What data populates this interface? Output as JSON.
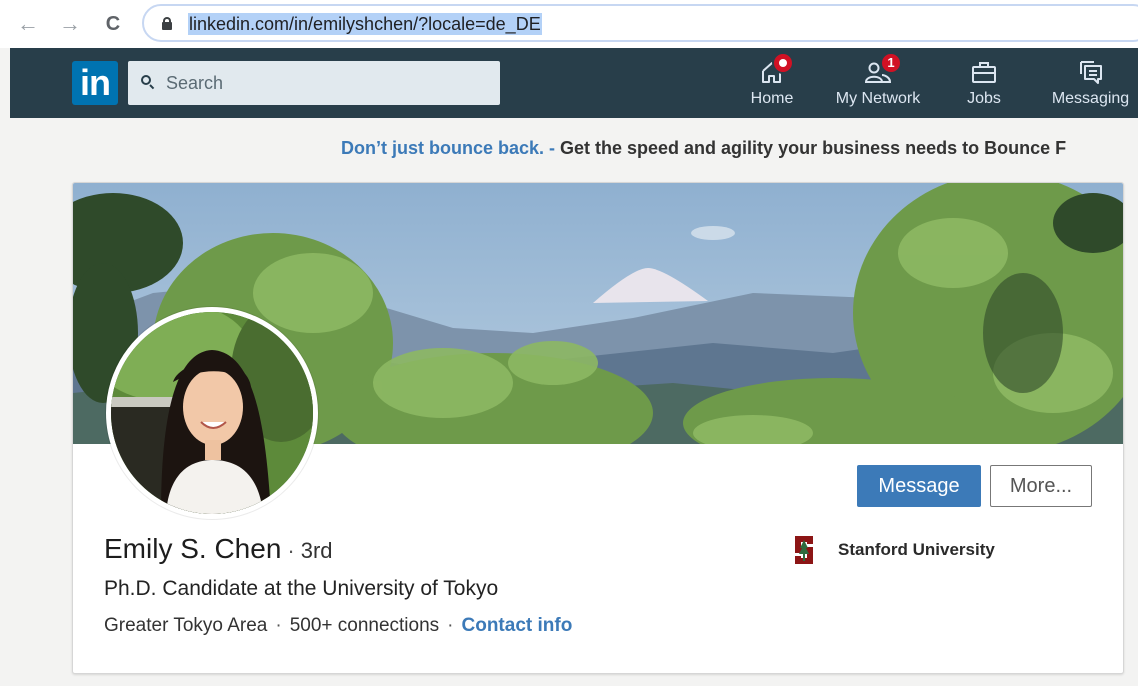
{
  "browser": {
    "back_icon": "arrow-left-icon",
    "forward_icon": "arrow-right-icon",
    "reload_icon": "reload-icon",
    "lock_icon": "lock-icon",
    "url": "linkedin.com/in/emilyshchen/?locale=de_DE"
  },
  "nav": {
    "logo": "in",
    "search_placeholder": "Search",
    "items": [
      {
        "label": "Home",
        "icon": "home-icon",
        "badge": "dot"
      },
      {
        "label": "My Network",
        "icon": "network-icon",
        "badge": "1"
      },
      {
        "label": "Jobs",
        "icon": "briefcase-icon",
        "badge": ""
      },
      {
        "label": "Messaging",
        "icon": "messaging-icon",
        "badge": ""
      }
    ]
  },
  "ad": {
    "link": "Don’t just bounce back. -",
    "text": " Get the speed and agility your business needs to Bounce F"
  },
  "profile": {
    "name": "Emily S. Chen",
    "separator": "·",
    "degree": "3rd",
    "headline": "Ph.D. Candidate at the University of Tokyo",
    "location": "Greater Tokyo Area",
    "connections": "500+ connections",
    "contact_info": "Contact info",
    "school": "Stanford University",
    "buttons": {
      "message": "Message",
      "more": "More..."
    }
  },
  "colors": {
    "nav_bg": "#283e4a",
    "brand_blue": "#0073b1",
    "link_blue": "#3c7ab8",
    "badge_red": "#d11124",
    "stanford_red": "#8c1515"
  }
}
